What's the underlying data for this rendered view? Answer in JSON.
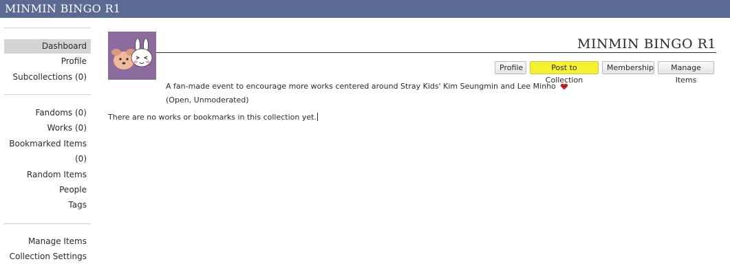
{
  "site": {
    "title": "MINMIN BINGO R1"
  },
  "sidebar": {
    "group1": [
      {
        "label": "Dashboard",
        "active": true
      },
      {
        "label": "Profile"
      },
      {
        "label": "Subcollections (0)"
      }
    ],
    "group2": [
      {
        "label": "Fandoms (0)"
      },
      {
        "label": "Works (0)"
      },
      {
        "label": "Bookmarked Items"
      },
      {
        "label": "(0)"
      },
      {
        "label": "Random Items"
      },
      {
        "label": "People"
      },
      {
        "label": "Tags"
      }
    ],
    "group3": [
      {
        "label": "Manage Items"
      },
      {
        "label": "Collection Settings"
      }
    ]
  },
  "collection": {
    "title": "MINMIN BINGO R1",
    "summary": "A fan-made event to encourage more works centered around Stray Kids' Kim Seungmin and Lee Minho",
    "status": "(Open, Unmoderated)",
    "empty_message": "There are no works or bookmarks in this collection yet."
  },
  "actions": {
    "profile": "Profile",
    "post": "Post to Collection",
    "membership": "Membership",
    "manage": "Manage Items"
  },
  "colors": {
    "topbar": "#5b6a92",
    "highlight": "#f4f230",
    "avatar_bg": "#8c6b9f"
  }
}
